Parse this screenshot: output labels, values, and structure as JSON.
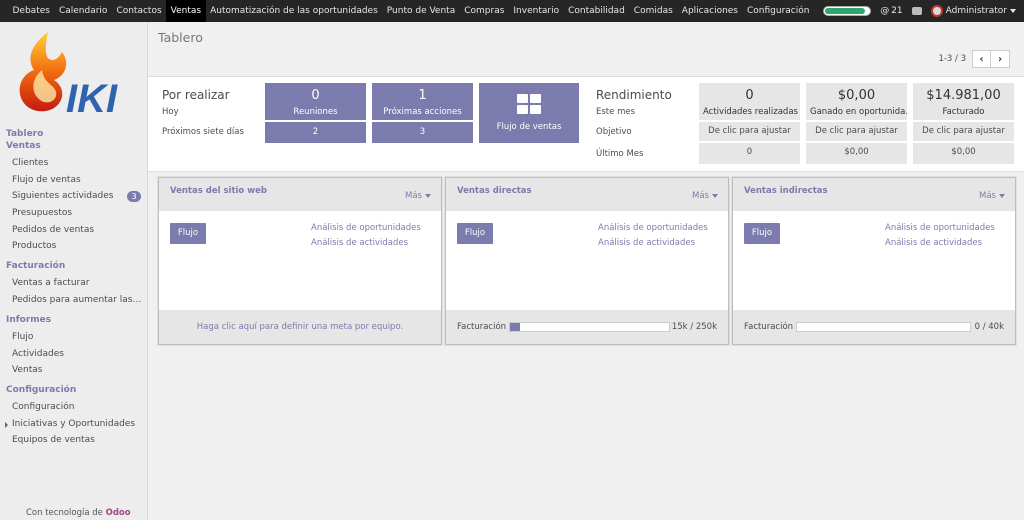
{
  "topbar": {
    "menu": [
      "Debates",
      "Calendario",
      "Contactos",
      "Ventas",
      "Automatización de las oportunidades",
      "Punto de Venta",
      "Compras",
      "Inventario",
      "Contabilidad",
      "Comidas",
      "Aplicaciones",
      "Configuración"
    ],
    "active_menu": "Ventas",
    "mentions": "21",
    "user": "Administrator"
  },
  "sidebar": {
    "logo_text": "IKI",
    "groups": [
      {
        "heads": [
          "Tablero",
          "Ventas"
        ],
        "items": [
          {
            "label": "Clientes"
          },
          {
            "label": "Flujo de ventas"
          },
          {
            "label": "Siguientes actividades",
            "badge": "3"
          },
          {
            "label": "Presupuestos"
          },
          {
            "label": "Pedidos de ventas"
          },
          {
            "label": "Productos"
          }
        ]
      },
      {
        "heads": [
          "Facturación"
        ],
        "items": [
          {
            "label": "Ventas a facturar"
          },
          {
            "label": "Pedidos para aumentar las…"
          }
        ]
      },
      {
        "heads": [
          "Informes"
        ],
        "items": [
          {
            "label": "Flujo"
          },
          {
            "label": "Actividades"
          },
          {
            "label": "Ventas"
          }
        ]
      },
      {
        "heads": [
          "Configuración"
        ],
        "items": [
          {
            "label": "Configuración"
          },
          {
            "label": "Iniciativas y Oportunidades",
            "tree": true
          },
          {
            "label": "Equipos de ventas"
          }
        ]
      }
    ],
    "powered_prefix": "Con tecnología de",
    "powered_brand": "Odoo"
  },
  "header": {
    "title": "Tablero",
    "pager": "1-3 / 3",
    "prev": "‹",
    "next": "›"
  },
  "todo": {
    "title": "Por realizar",
    "today": "Hoy",
    "next7": "Próximos siete días",
    "meetings": {
      "label": "Reuniones",
      "today": "0",
      "next7": "2"
    },
    "next_actions": {
      "label": "Próximas acciones",
      "today": "1",
      "next7": "3"
    },
    "pipeline": {
      "label": "Flujo de ventas"
    }
  },
  "performance": {
    "title": "Rendimiento",
    "rows": [
      "Este mes",
      "Objetivo",
      "Último Mes"
    ],
    "columns": [
      {
        "value": "0",
        "label": "Actividades realizadas",
        "target": "De clic para ajustar",
        "last": "0"
      },
      {
        "value": "$0,00",
        "label": "Ganado en oportunida…",
        "target": "De clic para ajustar",
        "last": "$0,00"
      },
      {
        "value": "$14.981,00",
        "label": "Facturado",
        "target": "De clic para ajustar",
        "last": "$0,00"
      }
    ]
  },
  "teams": [
    {
      "name": "Ventas del sitio web",
      "more": "Más",
      "button": "Flujo",
      "links": [
        "Análisis de oportunidades",
        "Análisis de actividades"
      ],
      "footer_link": "Haga clic aquí para definir una meta por equipo."
    },
    {
      "name": "Ventas directas",
      "more": "Más",
      "button": "Flujo",
      "links": [
        "Análisis de oportunidades",
        "Análisis de actividades"
      ],
      "footer_label": "Facturación",
      "footer_value": "15k / 250k",
      "progress": 0.06
    },
    {
      "name": "Ventas indirectas",
      "more": "Más",
      "button": "Flujo",
      "links": [
        "Análisis de oportunidades",
        "Análisis de actividades"
      ],
      "footer_label": "Facturación",
      "footer_value": "0 / 40k",
      "progress": 0
    }
  ]
}
